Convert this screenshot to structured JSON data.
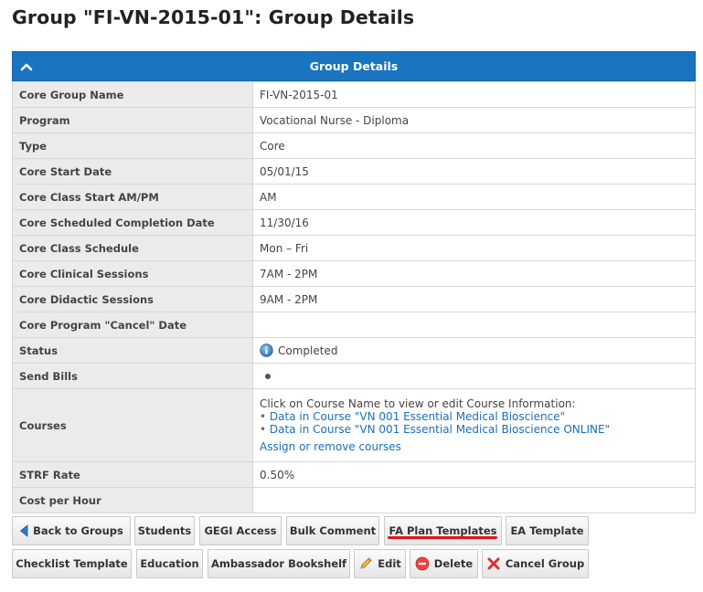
{
  "page": {
    "title": "Group \"FI-VN-2015-01\": Group Details"
  },
  "panel": {
    "header": "Group Details"
  },
  "details": {
    "rows": [
      {
        "label": "Core Group Name",
        "value": "FI-VN-2015-01"
      },
      {
        "label": "Program",
        "value": "Vocational Nurse - Diploma"
      },
      {
        "label": "Type",
        "value": "Core"
      },
      {
        "label": "Core Start Date",
        "value": "05/01/15"
      },
      {
        "label": "Core Class Start AM/PM",
        "value": "AM"
      },
      {
        "label": "Core Scheduled Completion Date",
        "value": "11/30/16"
      },
      {
        "label": "Core Class Schedule",
        "value": "Mon – Fri"
      },
      {
        "label": "Core Clinical Sessions",
        "value": "7AM - 2PM"
      },
      {
        "label": "Core Didactic Sessions",
        "value": "9AM - 2PM"
      },
      {
        "label": "Core Program \"Cancel\" Date",
        "value": ""
      }
    ],
    "status": {
      "label": "Status",
      "value": "Completed",
      "icon": "info-icon"
    },
    "send_bills": {
      "label": "Send Bills",
      "icon": "bullet-dot"
    },
    "courses": {
      "label": "Courses",
      "intro": "Click on Course Name to view or edit Course Information:",
      "items": [
        "Data in Course \"VN 001 Essential Medical Bioscience\"",
        "Data in Course \"VN 001 Essential Medical Bioscience ONLINE\""
      ],
      "assign_link": "Assign or remove courses"
    },
    "strf": {
      "label": "STRF Rate",
      "value": "0.50%"
    },
    "cost": {
      "label": "Cost per Hour",
      "value": ""
    }
  },
  "buttons": {
    "back": "Back to Groups",
    "students": "Students",
    "gegi": "GEGI Access",
    "bulk_comment": "Bulk Comment",
    "fa_plan": "FA Plan Templates",
    "ea_template": "EA Template",
    "checklist": "Checklist Template",
    "education": "Education",
    "ambassador": "Ambassador Bookshelf",
    "edit": "Edit",
    "delete": "Delete",
    "cancel_group": "Cancel Group"
  },
  "colors": {
    "header_bg": "#1a74c0",
    "link": "#1a6fb8",
    "annotation_underline": "#e0141e"
  }
}
